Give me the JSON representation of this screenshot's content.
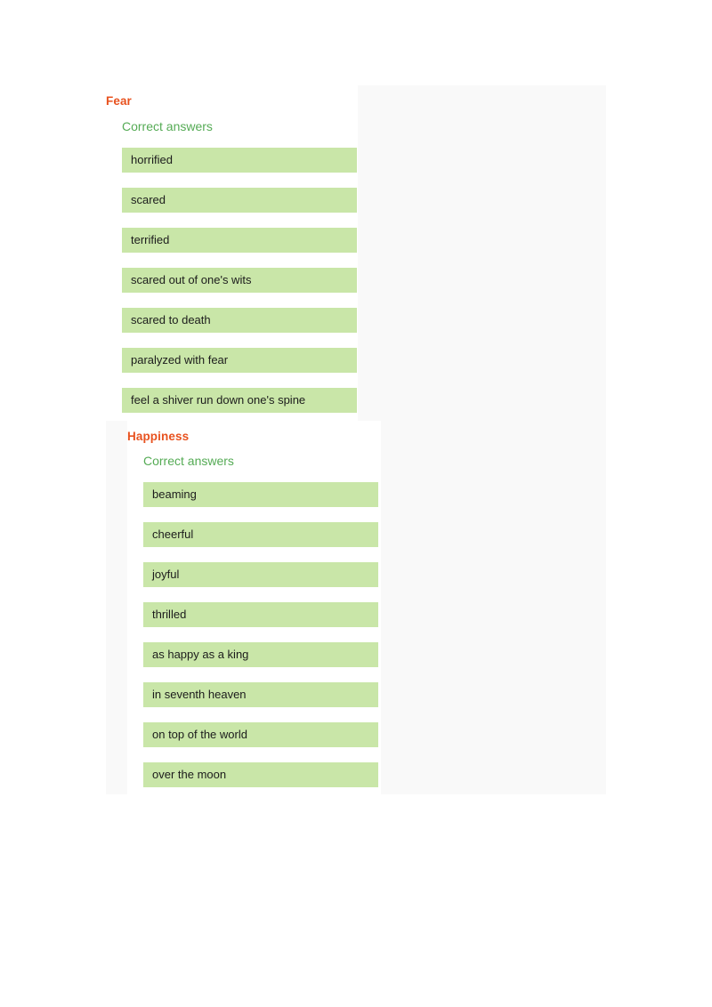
{
  "panel": {
    "accent_heading_color": "#e8521f",
    "accent_label_color": "#55ab55",
    "answer_chip_color": "#c9e6a8",
    "panel_background_color": "#f9f9f9",
    "section_background_color": "#ffffff"
  },
  "sections": [
    {
      "title": "Fear",
      "answers_label": "Correct answers",
      "answers": [
        "horrified",
        "scared",
        "terrified",
        "scared out of one's wits",
        "scared to death",
        "paralyzed with fear",
        "feel a shiver run down one's spine"
      ]
    },
    {
      "title": "Happiness",
      "answers_label": "Correct answers",
      "answers": [
        "beaming",
        "cheerful",
        "joyful",
        "thrilled",
        "as happy as a king",
        "in seventh heaven",
        "on top of the world",
        "over the moon"
      ]
    }
  ]
}
